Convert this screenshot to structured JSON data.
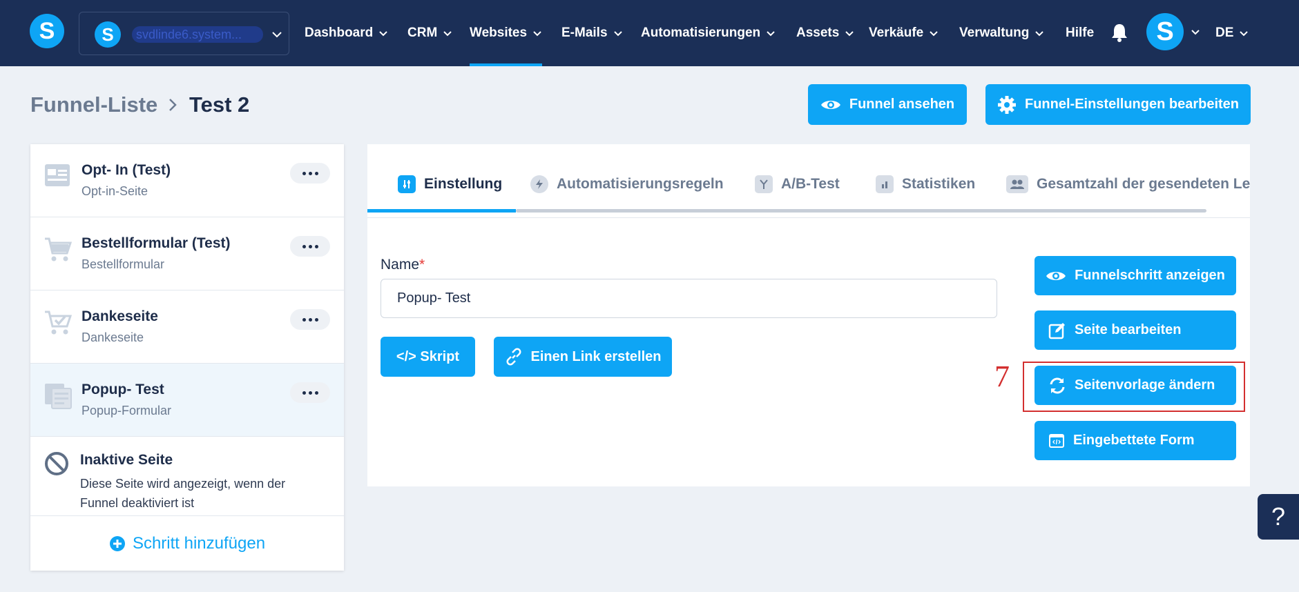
{
  "nav": {
    "account_name": "svdlinde6.system...",
    "items": [
      {
        "label": "Dashboard"
      },
      {
        "label": "CRM"
      },
      {
        "label": "Websites"
      },
      {
        "label": "E-Mails"
      },
      {
        "label": "Automatisierungen"
      },
      {
        "label": "Assets"
      },
      {
        "label": "Verkäufe"
      },
      {
        "label": "Verwaltung"
      }
    ],
    "help_label": "Hilfe",
    "language": "DE",
    "logo_letter": "S",
    "avatar_letter": "S"
  },
  "breadcrumb": {
    "root": "Funnel-Liste",
    "current": "Test 2"
  },
  "header_buttons": {
    "view_funnel": "Funnel ansehen",
    "edit_settings": "Funnel-Einstellungen bearbeiten"
  },
  "steps": [
    {
      "title": "Opt- In (Test)",
      "subtitle": "Opt-in-Seite",
      "icon": "optin-page-icon"
    },
    {
      "title": "Bestellformular (Test)",
      "subtitle": "Bestellformular",
      "icon": "cart-icon"
    },
    {
      "title": "Dankeseite",
      "subtitle": "Dankeseite",
      "icon": "cart-check-icon"
    },
    {
      "title": "Popup- Test",
      "subtitle": "Popup-Formular",
      "icon": "popup-form-icon"
    }
  ],
  "inactive": {
    "title": "Inaktive Seite",
    "description": "Diese Seite wird angezeigt, wenn der Funnel deaktiviert ist"
  },
  "add_step_label": "Schritt hinzufügen",
  "tabs": [
    {
      "label": "Einstellung"
    },
    {
      "label": "Automatisierungsregeln"
    },
    {
      "label": "A/B-Test"
    },
    {
      "label": "Statistiken"
    },
    {
      "label": "Gesamtzahl der gesendeten Le"
    }
  ],
  "form": {
    "name_label": "Name",
    "required_mark": "*",
    "name_value": "Popup- Test"
  },
  "actions": {
    "script": "</> Skript",
    "create_link": "Einen Link erstellen"
  },
  "side_actions": {
    "show_step": "Funnelschritt anzeigen",
    "edit_page": "Seite bearbeiten",
    "change_template": "Seitenvorlage ändern",
    "embedded_form": "Eingebettete Form"
  },
  "annotation_number": "7",
  "help_fab": "?",
  "colors": {
    "nav_bg": "#1b2f57",
    "accent": "#0ea5f5",
    "annotation": "#d32f2f"
  }
}
